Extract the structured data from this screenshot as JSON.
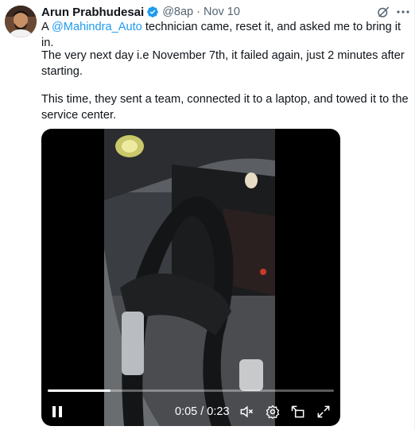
{
  "tweet": {
    "author": "Arun Prabhudesai",
    "handle": "@8ap",
    "separator": "·",
    "date": "Nov 10",
    "p1_before": "A ",
    "mention": "@Mahindra_Auto",
    "p1_after": " technician came, reset it, and asked me to bring it in.",
    "p2": "The very next day i.e November 7th, it failed again, just 2 minutes after starting.",
    "p3": "This time, they sent a team, connected it to a laptop, and towed it to the service center."
  },
  "video": {
    "time": "0:05 / 0:23",
    "progress_fraction": 0.22
  },
  "icons": [
    "verified-badge-icon",
    "grok-icon",
    "more-icon",
    "play-icon",
    "volume-mute-icon",
    "gear-icon",
    "captions-icon",
    "fullscreen-icon"
  ],
  "colors": {
    "accent": "#1d9bf0",
    "text": "#0f1419",
    "muted": "#536471"
  }
}
